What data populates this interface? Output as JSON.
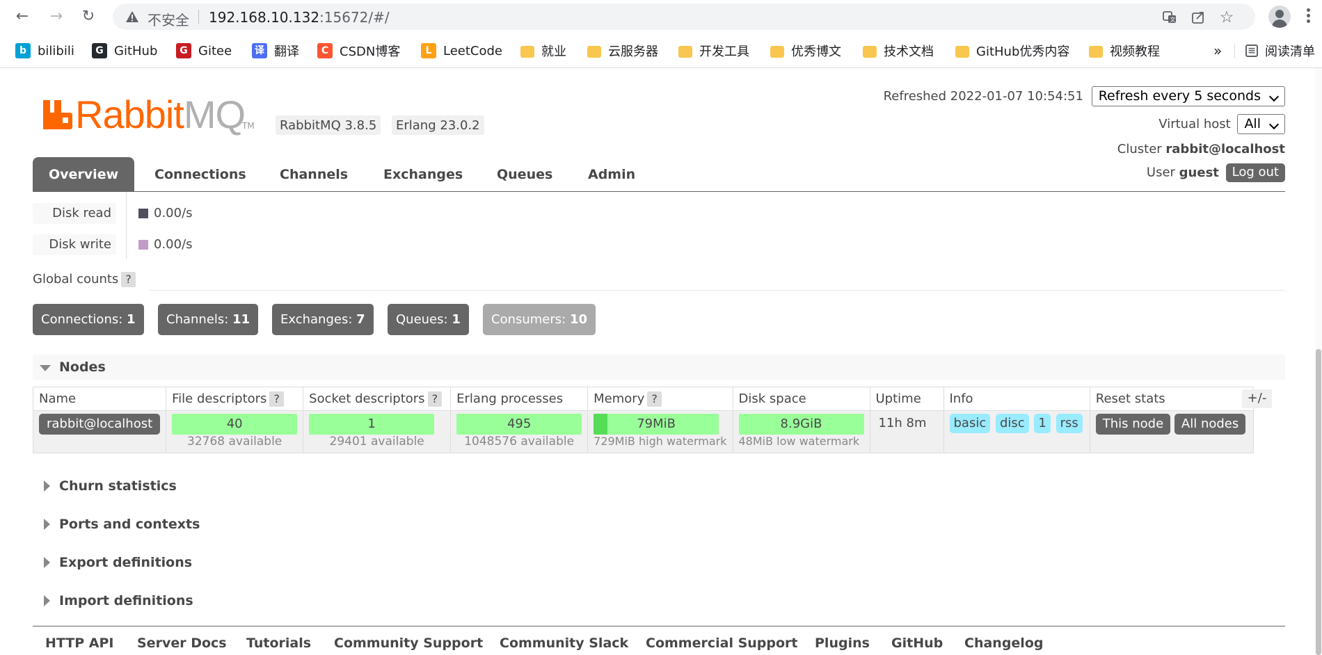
{
  "browser": {
    "insecure_label": "不安全",
    "url_host": "192.168.10.132",
    "url_path": ":15672/#/",
    "bookmarks": [
      {
        "label": "bilibili",
        "icon": "bilibili-icon",
        "color": "#00a1d6"
      },
      {
        "label": "GitHub",
        "icon": "github-icon",
        "color": "#24292e"
      },
      {
        "label": "Gitee",
        "icon": "gitee-icon",
        "color": "#c71d23"
      },
      {
        "label": "翻译",
        "icon": "translate-icon",
        "color": "#4e6ef2"
      },
      {
        "label": "CSDN博客",
        "icon": "csdn-icon",
        "color": "#fc5531"
      },
      {
        "label": "LeetCode",
        "icon": "leetcode-icon",
        "color": "#ffa116"
      },
      {
        "label": "就业",
        "icon": "folder-icon",
        "color": "#f9c74f"
      },
      {
        "label": "云服务器",
        "icon": "folder-icon",
        "color": "#f9c74f"
      },
      {
        "label": "开发工具",
        "icon": "folder-icon",
        "color": "#f9c74f"
      },
      {
        "label": "优秀博文",
        "icon": "folder-icon",
        "color": "#f9c74f"
      },
      {
        "label": "技术文档",
        "icon": "folder-icon",
        "color": "#f9c74f"
      },
      {
        "label": "GitHub优秀内容",
        "icon": "folder-icon",
        "color": "#f9c74f"
      },
      {
        "label": "视频教程",
        "icon": "folder-icon",
        "color": "#f9c74f"
      }
    ],
    "overflow_label": "»",
    "reading_list_label": "阅读清单"
  },
  "header": {
    "logo_rabbit": "Rabbit",
    "logo_mq": "MQ",
    "logo_tm": "TM",
    "rabbitmq_version": "RabbitMQ 3.8.5",
    "erlang_version": "Erlang 23.0.2",
    "refreshed_label": "Refreshed 2022-01-07 10:54:51",
    "refresh_option": "Refresh every 5 seconds",
    "vhost_label": "Virtual host",
    "vhost_value": "All",
    "cluster_label": "Cluster",
    "cluster_value": "rabbit@localhost",
    "user_label": "User",
    "user_value": "guest",
    "logout_label": "Log out"
  },
  "tabs": [
    "Overview",
    "Connections",
    "Channels",
    "Exchanges",
    "Queues",
    "Admin"
  ],
  "disk": {
    "read_label": "Disk read",
    "read_value": "0.00/s",
    "read_color": "#4f4f5f",
    "write_label": "Disk write",
    "write_value": "0.00/s",
    "write_color": "#c09cc8"
  },
  "global_counts": {
    "label": "Global counts",
    "help": "?",
    "items": [
      {
        "label": "Connections:",
        "value": "1"
      },
      {
        "label": "Channels:",
        "value": "11"
      },
      {
        "label": "Exchanges:",
        "value": "7"
      },
      {
        "label": "Queues:",
        "value": "1"
      },
      {
        "label": "Consumers:",
        "value": "10"
      }
    ]
  },
  "nodes": {
    "title": "Nodes",
    "columns": [
      "Name",
      "File descriptors",
      "Socket descriptors",
      "Erlang processes",
      "Memory",
      "Disk space",
      "Uptime",
      "Info",
      "Reset stats"
    ],
    "help": "?",
    "toggle_label": "+/-",
    "row": {
      "name": "rabbit@localhost",
      "file_descriptors": "40",
      "file_descriptors_sub": "32768 available",
      "socket_descriptors": "1",
      "socket_descriptors_sub": "29401 available",
      "erlang_processes": "495",
      "erlang_processes_sub": "1048576 available",
      "memory": "79MiB",
      "memory_fraction": 0.108,
      "memory_sub": "729MiB high watermark",
      "disk_space": "8.9GiB",
      "disk_space_sub": "48MiB low watermark",
      "uptime": "11h 8m",
      "info_tags": [
        "basic",
        "disc",
        "1",
        "rss"
      ],
      "reset_this": "This node",
      "reset_all": "All nodes"
    }
  },
  "sections": [
    "Churn statistics",
    "Ports and contexts",
    "Export definitions",
    "Import definitions"
  ],
  "footer": [
    "HTTP API",
    "Server Docs",
    "Tutorials",
    "Community Support",
    "Community Slack",
    "Commercial Support",
    "Plugins",
    "GitHub",
    "Changelog"
  ]
}
